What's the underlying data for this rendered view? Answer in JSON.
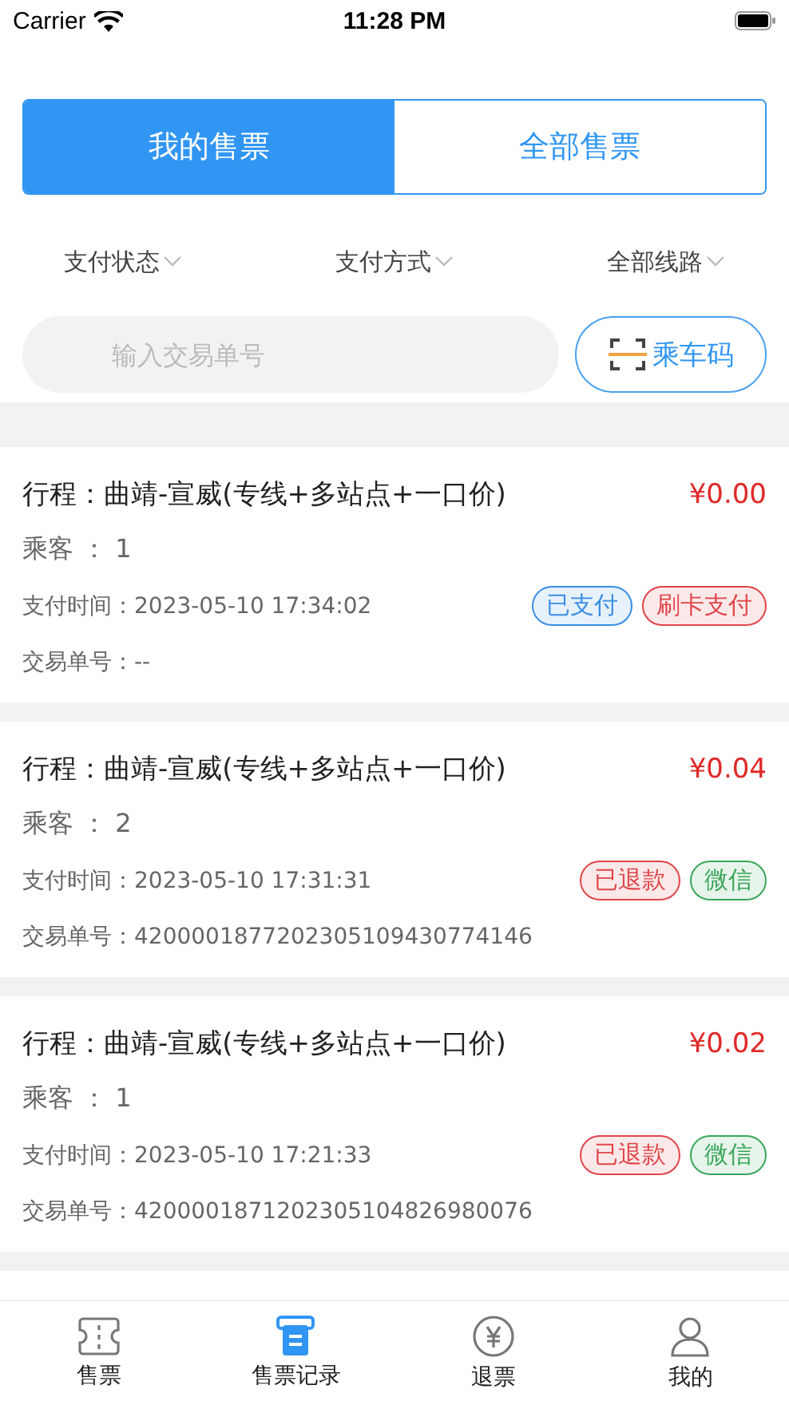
{
  "status_bar": {
    "carrier": "Carrier",
    "time": "11:28 PM"
  },
  "tabs": [
    {
      "label": "我的售票",
      "selected": true
    },
    {
      "label": "全部售票",
      "selected": false
    }
  ],
  "filters": [
    "支付状态",
    "支付方式",
    "全部线路"
  ],
  "search": {
    "placeholder": "输入交易单号"
  },
  "ride_code_button": "乘车码",
  "records": [
    {
      "trip": "行程：曲靖-宣威(专线+多站点+一口价)",
      "price": "¥0.00",
      "passengers": "乘客 ： 1",
      "pay_time": "支付时间：2023-05-10 17:34:02",
      "order_no": "交易单号：--",
      "tags": [
        {
          "label": "已支付",
          "color": "#3a8ee6"
        },
        {
          "label": "刷卡支付",
          "color": "#e0454a"
        }
      ]
    },
    {
      "trip": "行程：曲靖-宣威(专线+多站点+一口价)",
      "price": "¥0.04",
      "passengers": "乘客 ： 2",
      "pay_time": "支付时间：2023-05-10 17:31:31",
      "order_no": "交易单号：4200001877202305109430774146",
      "tags": [
        {
          "label": "已退款",
          "color": "#e0454a"
        },
        {
          "label": "微信",
          "color": "#3aa65a"
        }
      ]
    },
    {
      "trip": "行程：曲靖-宣威(专线+多站点+一口价)",
      "price": "¥0.02",
      "passengers": "乘客 ： 1",
      "pay_time": "支付时间：2023-05-10 17:21:33",
      "order_no": "交易单号：4200001871202305104826980076",
      "tags": [
        {
          "label": "已退款",
          "color": "#e0454a"
        },
        {
          "label": "微信",
          "color": "#3aa65a"
        }
      ]
    }
  ],
  "tab_bar": [
    {
      "label": "售票",
      "kind": "ticket",
      "selected": false
    },
    {
      "label": "售票记录",
      "kind": "record",
      "selected": true
    },
    {
      "label": "退票",
      "kind": "refund",
      "selected": false
    },
    {
      "label": "我的",
      "kind": "person",
      "selected": false
    }
  ]
}
